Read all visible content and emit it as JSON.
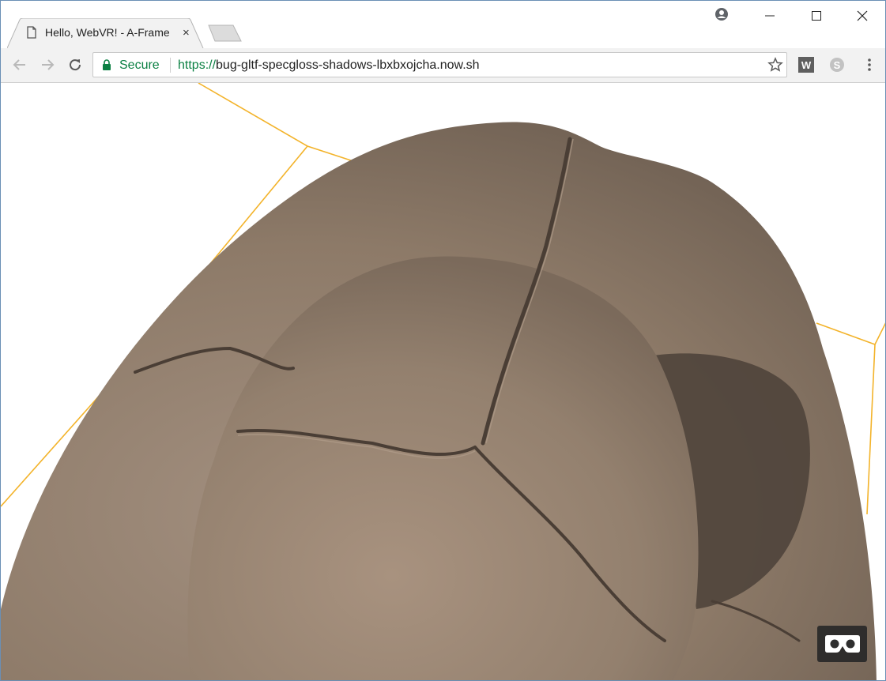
{
  "tab": {
    "title": "Hello, WebVR! - A-Frame",
    "close": "×"
  },
  "omnibox": {
    "secure_label": "Secure",
    "scheme": "https://",
    "host_path": "bug-gltf-specgloss-shadows-lbxbxojcha.now.sh"
  },
  "extensions": [
    {
      "icon": "w-extension-icon",
      "letter": "W"
    },
    {
      "icon": "skype-extension-icon",
      "letter": "S"
    }
  ],
  "scene": {
    "model_color": "#8d7a68",
    "wireframe_color": "#f3b32a"
  }
}
